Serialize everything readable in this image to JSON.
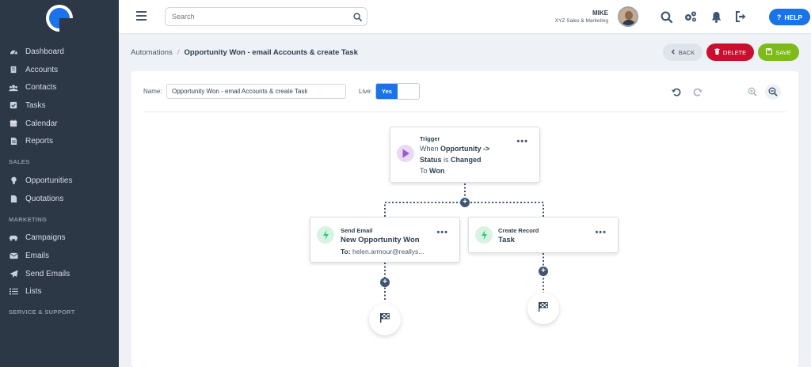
{
  "sidebar": {
    "items": [
      {
        "label": "Dashboard",
        "icon": "dashboard-icon"
      },
      {
        "label": "Accounts",
        "icon": "building-icon"
      },
      {
        "label": "Contacts",
        "icon": "users-icon"
      },
      {
        "label": "Tasks",
        "icon": "checkbox-icon"
      },
      {
        "label": "Calendar",
        "icon": "calendar-icon"
      },
      {
        "label": "Reports",
        "icon": "report-icon"
      }
    ],
    "sections": {
      "sales": "SALES",
      "marketing": "MARKETING",
      "service": "SERVICE & SUPPORT"
    },
    "sales_items": [
      {
        "label": "Opportunities",
        "icon": "lightbulb-icon"
      },
      {
        "label": "Quotations",
        "icon": "document-icon"
      }
    ],
    "marketing_items": [
      {
        "label": "Campaigns",
        "icon": "car-icon"
      },
      {
        "label": "Emails",
        "icon": "envelope-icon"
      },
      {
        "label": "Send Emails",
        "icon": "paper-plane-icon"
      },
      {
        "label": "Lists",
        "icon": "list-icon"
      }
    ]
  },
  "topbar": {
    "search_placeholder": "Search",
    "user_name": "MIKE",
    "user_org": "XYZ Sales & Marketing",
    "help_label": "HELP"
  },
  "breadcrumb": {
    "parent": "Automations",
    "separator": "/",
    "current": "Opportunity Won - email Accounts & create Task"
  },
  "actions": {
    "back": "BACK",
    "delete": "DELETE",
    "save": "SAVE"
  },
  "form": {
    "name_label": "Name:",
    "name_value": "Opportunity Won - email Accounts & create Task",
    "live_label": "Live:",
    "live_value": "Yes"
  },
  "flow": {
    "trigger": {
      "title": "Trigger",
      "line1_prefix": "When",
      "line1_bold": "Opportunity ->",
      "line2_bold1": "Status",
      "line2_mid": "is",
      "line2_bold2": "Changed",
      "line3_prefix": "To",
      "line3_bold": "Won",
      "menu": "•••"
    },
    "send_email": {
      "title": "Send Email",
      "subtitle": "New Opportunity Won",
      "to_label": "To:",
      "to_value": "helen.armour@reallys...",
      "menu": "•••"
    },
    "create_record": {
      "title": "Create Record",
      "subtitle": "Task",
      "menu": "•••"
    },
    "add_symbol": "+"
  },
  "colors": {
    "sidebar_bg": "#2d3847",
    "accent_blue": "#1a73e8",
    "delete_red": "#c8102e",
    "save_green": "#7dbb1b",
    "trigger_purple": "#9b59d0",
    "action_green": "#2ecc71"
  }
}
